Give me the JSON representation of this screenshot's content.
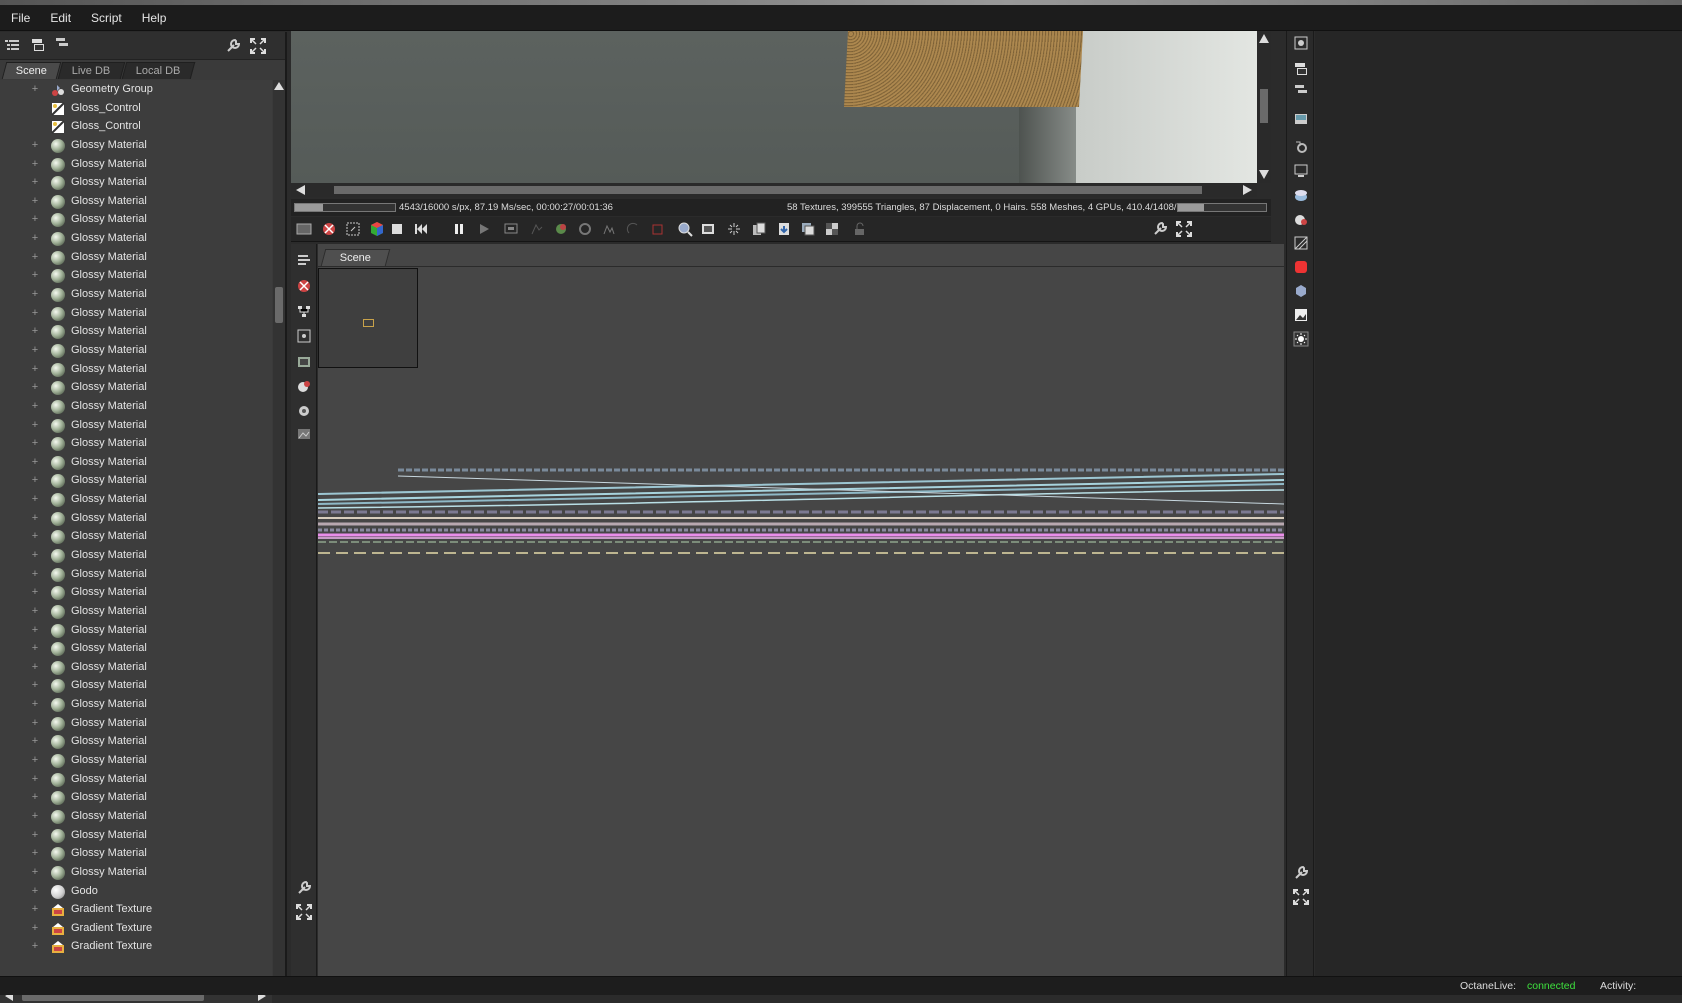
{
  "menu": [
    "File",
    "Edit",
    "Script",
    "Help"
  ],
  "outliner": {
    "tabs": [
      "Scene",
      "Live DB",
      "Local DB"
    ],
    "active_tab": "Scene",
    "items": [
      {
        "label": "Geometry Group",
        "icon": "geometry-group-icon",
        "expandable": true
      },
      {
        "label": "Gloss_Control",
        "icon": "texture-node-icon",
        "expandable": false
      },
      {
        "label": "Gloss_Control",
        "icon": "texture-node-icon",
        "expandable": false
      },
      {
        "label": "Glossy Material",
        "icon": "glossy-material-icon",
        "expandable": true
      },
      {
        "label": "Glossy Material",
        "icon": "glossy-material-icon",
        "expandable": true
      },
      {
        "label": "Glossy Material",
        "icon": "glossy-material-icon",
        "expandable": true
      },
      {
        "label": "Glossy Material",
        "icon": "glossy-material-icon",
        "expandable": true
      },
      {
        "label": "Glossy Material",
        "icon": "glossy-material-icon",
        "expandable": true
      },
      {
        "label": "Glossy Material",
        "icon": "glossy-material-icon",
        "expandable": true
      },
      {
        "label": "Glossy Material",
        "icon": "glossy-material-icon",
        "expandable": true
      },
      {
        "label": "Glossy Material",
        "icon": "glossy-material-icon",
        "expandable": true
      },
      {
        "label": "Glossy Material",
        "icon": "glossy-material-icon",
        "expandable": true
      },
      {
        "label": "Glossy Material",
        "icon": "glossy-material-icon",
        "expandable": true
      },
      {
        "label": "Glossy Material",
        "icon": "glossy-material-icon",
        "expandable": true
      },
      {
        "label": "Glossy Material",
        "icon": "glossy-material-icon",
        "expandable": true
      },
      {
        "label": "Glossy Material",
        "icon": "glossy-material-icon",
        "expandable": true
      },
      {
        "label": "Glossy Material",
        "icon": "glossy-material-icon",
        "expandable": true
      },
      {
        "label": "Glossy Material",
        "icon": "glossy-material-icon",
        "expandable": true
      },
      {
        "label": "Glossy Material",
        "icon": "glossy-material-icon",
        "expandable": true
      },
      {
        "label": "Glossy Material",
        "icon": "glossy-material-icon",
        "expandable": true
      },
      {
        "label": "Glossy Material",
        "icon": "glossy-material-icon",
        "expandable": true
      },
      {
        "label": "Glossy Material",
        "icon": "glossy-material-icon",
        "expandable": true
      },
      {
        "label": "Glossy Material",
        "icon": "glossy-material-icon",
        "expandable": true
      },
      {
        "label": "Glossy Material",
        "icon": "glossy-material-icon",
        "expandable": true
      },
      {
        "label": "Glossy Material",
        "icon": "glossy-material-icon",
        "expandable": true
      },
      {
        "label": "Glossy Material",
        "icon": "glossy-material-icon",
        "expandable": true
      },
      {
        "label": "Glossy Material",
        "icon": "glossy-material-icon",
        "expandable": true
      },
      {
        "label": "Glossy Material",
        "icon": "glossy-material-icon",
        "expandable": true
      },
      {
        "label": "Glossy Material",
        "icon": "glossy-material-icon",
        "expandable": true
      },
      {
        "label": "Glossy Material",
        "icon": "glossy-material-icon",
        "expandable": true
      },
      {
        "label": "Glossy Material",
        "icon": "glossy-material-icon",
        "expandable": true
      },
      {
        "label": "Glossy Material",
        "icon": "glossy-material-icon",
        "expandable": true
      },
      {
        "label": "Glossy Material",
        "icon": "glossy-material-icon",
        "expandable": true
      },
      {
        "label": "Glossy Material",
        "icon": "glossy-material-icon",
        "expandable": true
      },
      {
        "label": "Glossy Material",
        "icon": "glossy-material-icon",
        "expandable": true
      },
      {
        "label": "Glossy Material",
        "icon": "glossy-material-icon",
        "expandable": true
      },
      {
        "label": "Glossy Material",
        "icon": "glossy-material-icon",
        "expandable": true
      },
      {
        "label": "Glossy Material",
        "icon": "glossy-material-icon",
        "expandable": true
      },
      {
        "label": "Glossy Material",
        "icon": "glossy-material-icon",
        "expandable": true
      },
      {
        "label": "Glossy Material",
        "icon": "glossy-material-icon",
        "expandable": true
      },
      {
        "label": "Glossy Material",
        "icon": "glossy-material-icon",
        "expandable": true
      },
      {
        "label": "Glossy Material",
        "icon": "glossy-material-icon",
        "expandable": true
      },
      {
        "label": "Glossy Material",
        "icon": "glossy-material-icon",
        "expandable": true
      },
      {
        "label": "Godo",
        "icon": "diffuse-material-icon",
        "expandable": true
      },
      {
        "label": "Gradient Texture",
        "icon": "gradient-texture-icon",
        "expandable": true
      },
      {
        "label": "Gradient Texture",
        "icon": "gradient-texture-icon",
        "expandable": true
      },
      {
        "label": "Gradient Texture",
        "icon": "gradient-texture-icon",
        "expandable": true
      }
    ]
  },
  "render_status": {
    "left_text": "4543/16000 s/px, 87.19 Ms/sec, 00:00:27/00:01:36",
    "right_text": "58 Textures, 399555 Triangles, 87 Displacement, 0 Hairs. 558 Meshes, 4 GPUs, 410.4/1408/153...",
    "progress": 0.28,
    "memory_fraction": 0.3
  },
  "graph_editor": {
    "tab": "Scene"
  },
  "statusbar": {
    "octanelive_label": "OctaneLive:",
    "octanelive_value": "connected",
    "activity_label": "Activity:"
  },
  "colors": {
    "connected": "#3ee03e",
    "minimap_node": "#c8a24a"
  }
}
